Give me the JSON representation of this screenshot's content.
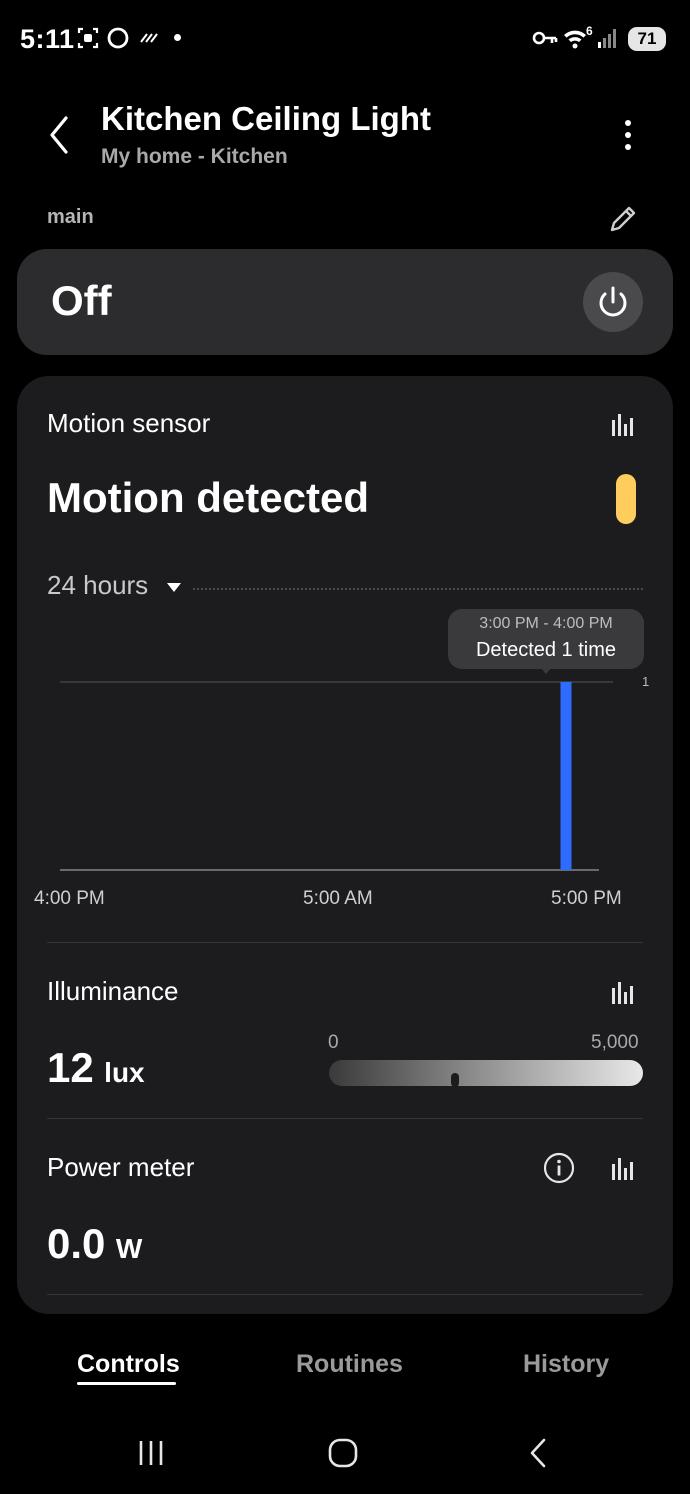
{
  "status_bar": {
    "time": "5:11",
    "battery": "71",
    "wifi_label": "6"
  },
  "header": {
    "title": "Kitchen Ceiling Light",
    "subtitle": "My home - Kitchen"
  },
  "component_label": "main",
  "power": {
    "state": "Off"
  },
  "motion_sensor": {
    "title": "Motion sensor",
    "value": "Motion detected",
    "range_selector": "24 hours",
    "tooltip": {
      "time_range": "3:00 PM - 4:00 PM",
      "text": "Detected 1 time"
    },
    "y_max_label": "1",
    "x_labels": [
      "4:00 PM",
      "5:00 AM",
      "5:00 PM"
    ]
  },
  "chart_data": {
    "type": "bar",
    "x_labels": [
      "4:00 PM",
      "5:00 AM",
      "5:00 PM"
    ],
    "y_ticks": [
      1
    ],
    "ylim": [
      0,
      1
    ],
    "bars": [
      {
        "hour_index": 23,
        "value": 1
      }
    ],
    "hours": 25,
    "colors": {
      "bar": "#2f6bff",
      "gridline": "#4a4a4a"
    }
  },
  "illuminance": {
    "title": "Illuminance",
    "value": "12",
    "unit": "lux",
    "scale_min": "0",
    "scale_max": "5,000",
    "level_fraction": 0.4
  },
  "power_meter": {
    "title": "Power meter",
    "value": "0.0",
    "unit": "W"
  },
  "tabs": [
    {
      "label": "Controls",
      "active": true
    },
    {
      "label": "Routines",
      "active": false
    },
    {
      "label": "History",
      "active": false
    }
  ],
  "colors": {
    "accent_pill": "#ffcd5e",
    "bar": "#2f6bff",
    "card": "#1c1c1e",
    "power_card": "#2c2c2e"
  }
}
